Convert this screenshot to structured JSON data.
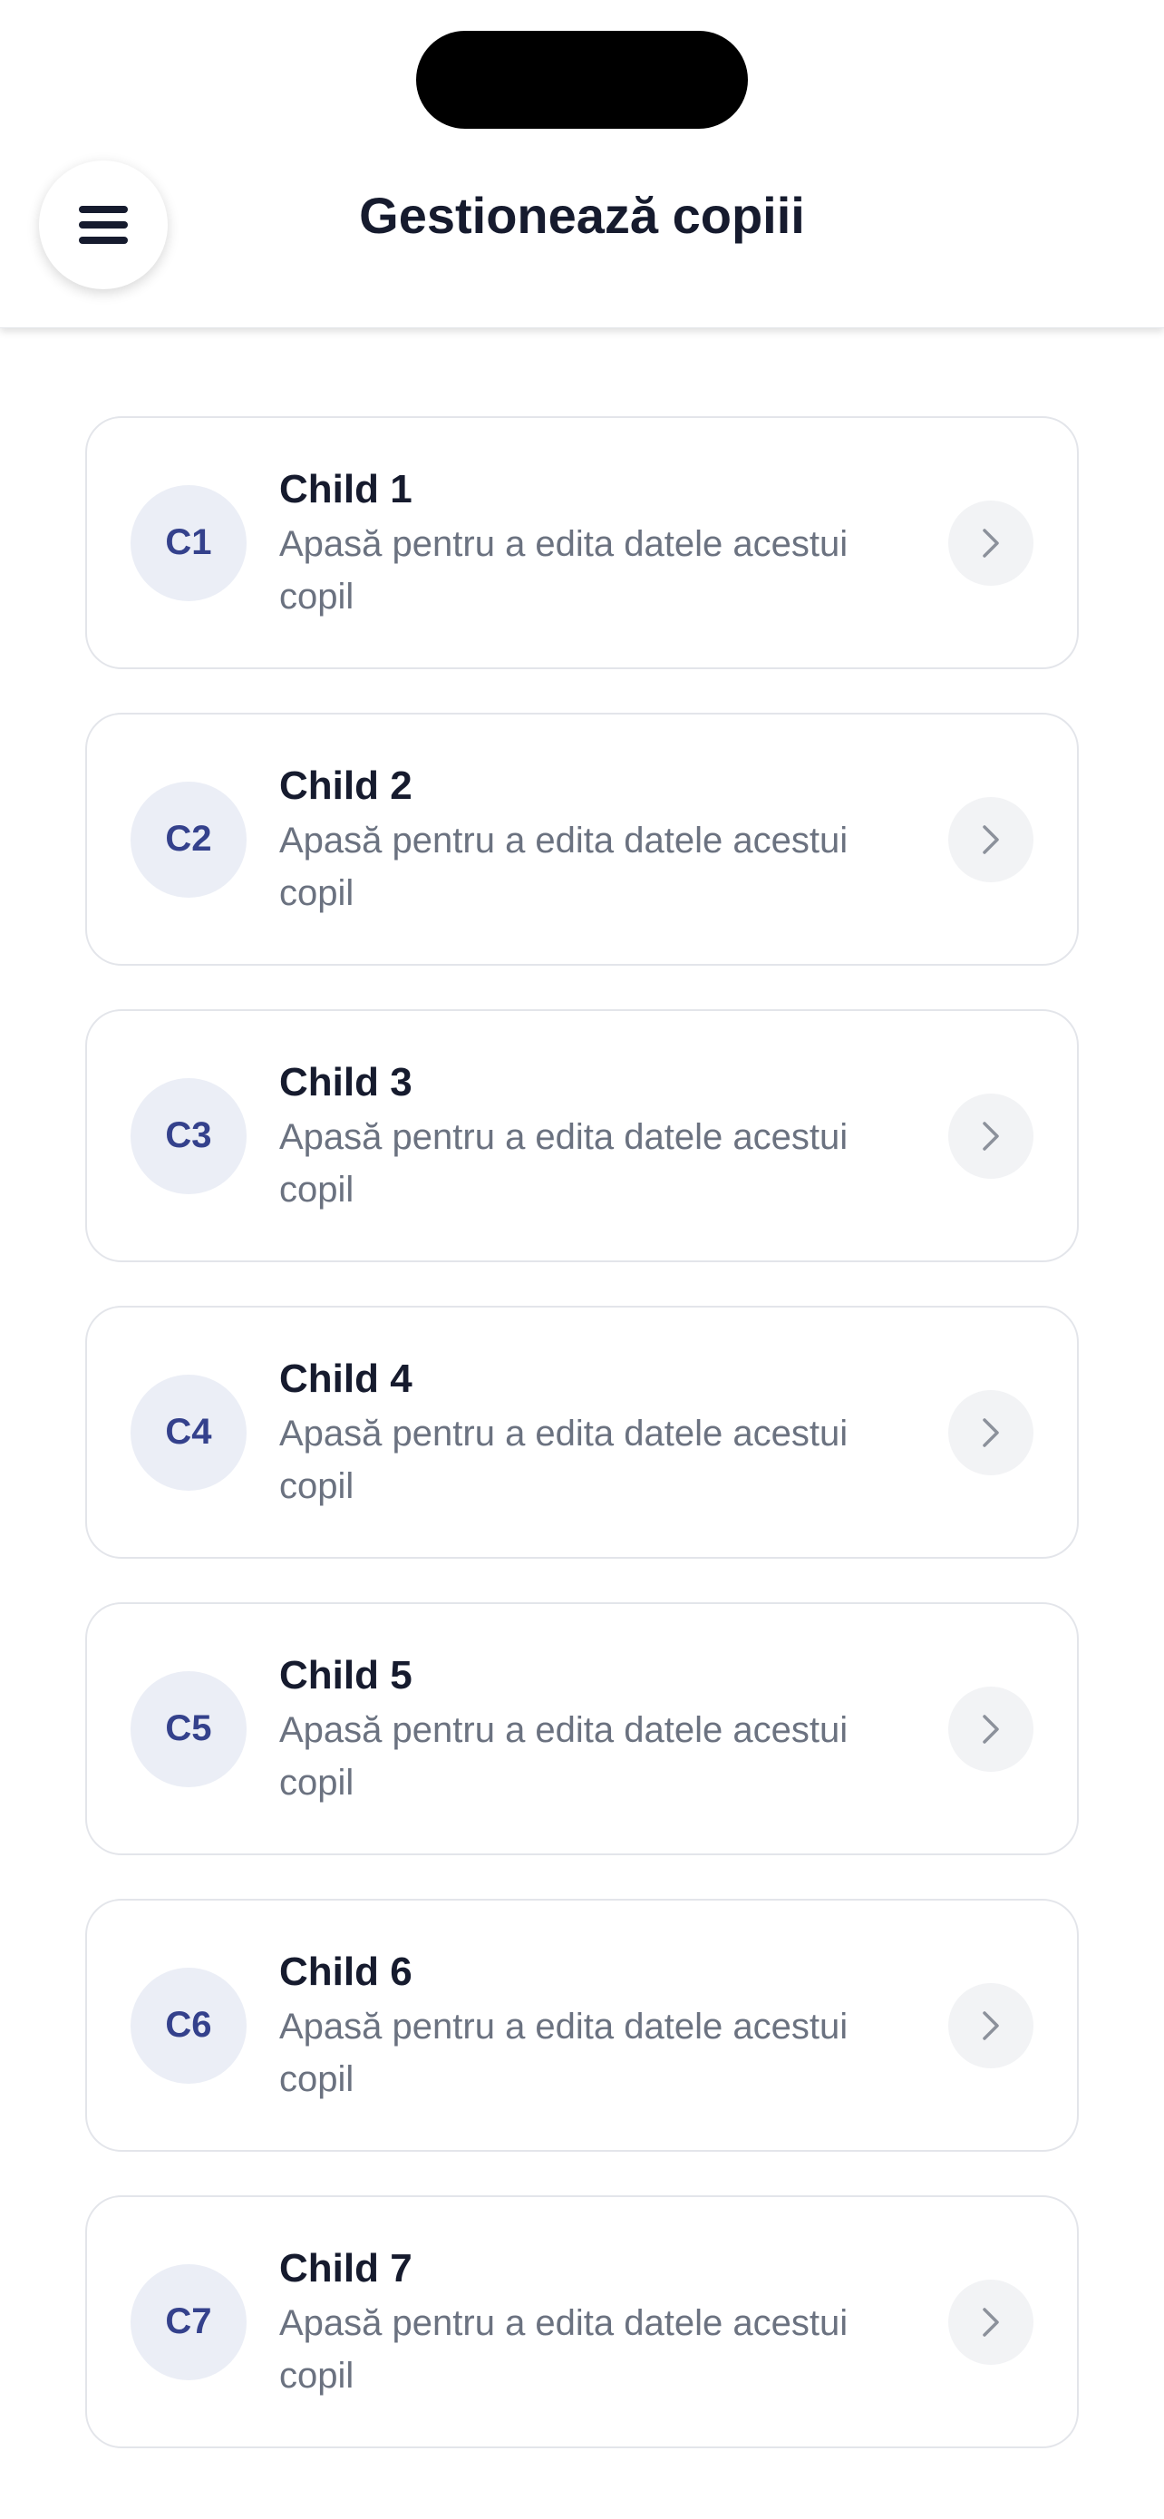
{
  "header": {
    "title": "Gestionează copiii",
    "menu_icon": "hamburger-icon"
  },
  "children": [
    {
      "initials": "C1",
      "name": "Child 1",
      "description": "Apasă pentru a edita datele acestui copil"
    },
    {
      "initials": "C2",
      "name": "Child 2",
      "description": "Apasă pentru a edita datele acestui copil"
    },
    {
      "initials": "C3",
      "name": "Child 3",
      "description": "Apasă pentru a edita datele acestui copil"
    },
    {
      "initials": "C4",
      "name": "Child 4",
      "description": "Apasă pentru a edita datele acestui copil"
    },
    {
      "initials": "C5",
      "name": "Child 5",
      "description": "Apasă pentru a edita datele acestui copil"
    },
    {
      "initials": "C6",
      "name": "Child 6",
      "description": "Apasă pentru a edita datele acestui copil"
    },
    {
      "initials": "C7",
      "name": "Child 7",
      "description": "Apasă pentru a edita datele acestui copil"
    }
  ],
  "colors": {
    "title": "#161b2e",
    "avatar_bg": "#ebeef6",
    "avatar_text": "#34418c",
    "description": "#6b7280",
    "chevron_bg": "#f2f3f5"
  }
}
